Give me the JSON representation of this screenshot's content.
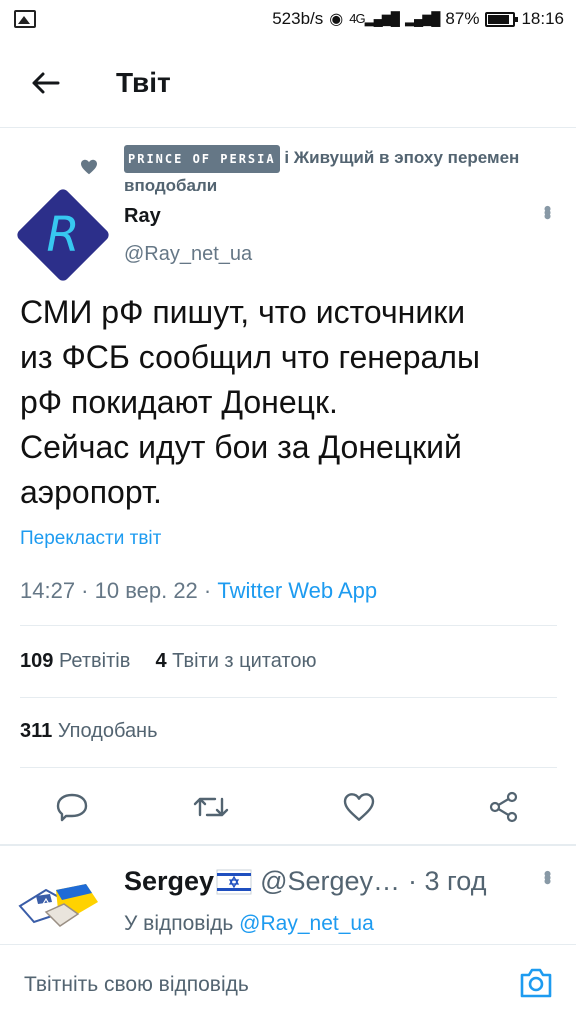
{
  "status_bar": {
    "speed": "523b/s",
    "network": "4G",
    "battery": "87%",
    "battery_level": 0.87,
    "time": "18:16"
  },
  "header": {
    "back_icon": "arrow-left-icon",
    "title": "Твіт"
  },
  "social_context": {
    "liker_name": "PRINCE OF PERSIA",
    "text": "і Живущий в эпоху перемен вподобали"
  },
  "tweet": {
    "author_name": "Ray",
    "author_handle": "@Ray_net_ua",
    "avatar_letter": "R",
    "text_lines": [
      "СМИ рФ пишут, что источники",
      "из ФСБ сообщил что генералы",
      "рФ покидают Донецк.",
      "Сейчас идут бои за Донецкий",
      "аэропорт."
    ],
    "translate_label": "Перекласти твіт",
    "timestamp": "14:27 · 10 вер. 22 · ",
    "source_app": "Twitter Web App",
    "retweets_count": "109",
    "retweets_label": "Ретвітів",
    "quotes_count": "4",
    "quotes_label": "Твіти з цитатою",
    "likes_count": "311",
    "likes_label": "Уподобань"
  },
  "reply": {
    "author_name": "Sergey",
    "author_handle": "@Sergey…",
    "time": "· 3 год",
    "reply_prefix": "У відповідь",
    "reply_mention": "@Ray_net_ua"
  },
  "compose": {
    "placeholder": "Твітніть свою відповідь"
  },
  "colors": {
    "accent": "#1d9bf0",
    "secondary_text": "#536471",
    "divider": "#e6ecf0"
  }
}
